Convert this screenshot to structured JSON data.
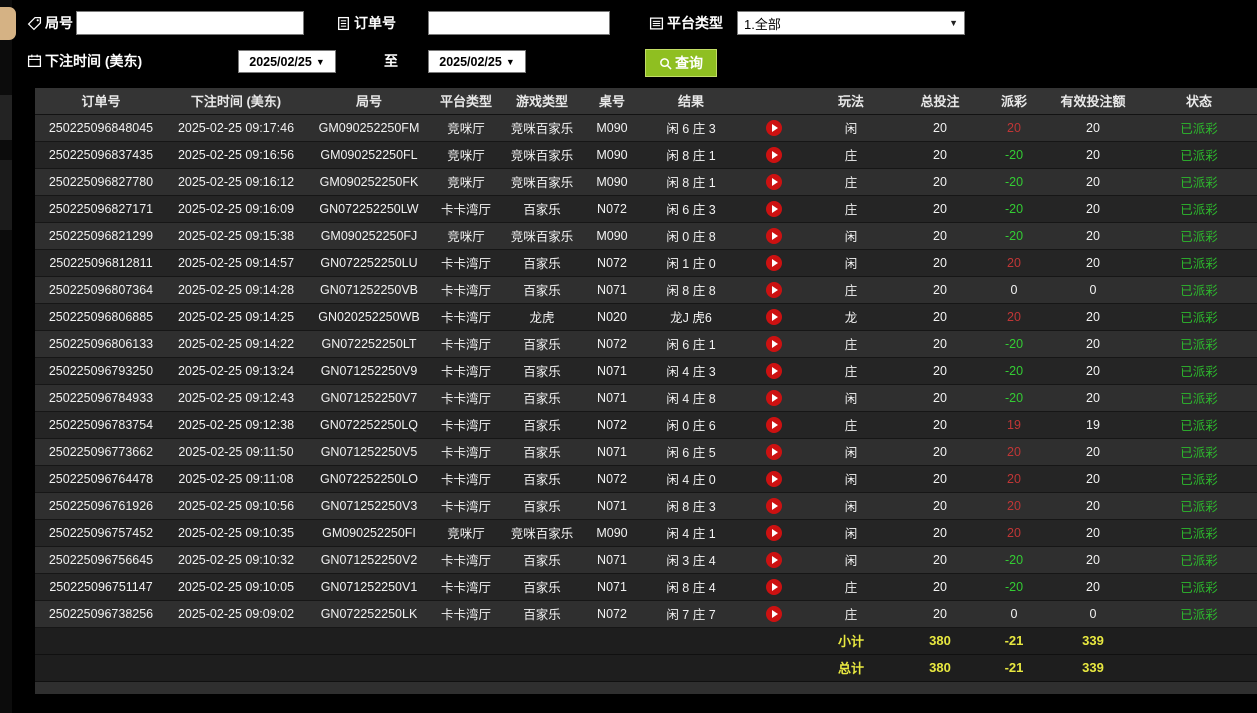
{
  "colors": {
    "query_button_green": "#8fbf21",
    "payout_positive_red": "#c03636",
    "payout_negative_green": "#33cc33",
    "status_green": "#2db82d",
    "summary_yellow": "#e8e840",
    "drawer_handle_tan": "#d5b284"
  },
  "icons": {
    "round": "tag-icon",
    "order": "document-icon",
    "platform": "list-icon",
    "bet_time": "calendar-icon",
    "query": "search-icon",
    "dropdown": "caret-down-icon",
    "replay": "play-icon"
  },
  "filters": {
    "round": {
      "label": "局号",
      "value": ""
    },
    "order": {
      "label": "订单号",
      "value": ""
    },
    "platform": {
      "label": "平台类型",
      "value": "1.全部",
      "arrow": "▼"
    },
    "bet_time": {
      "label": "下注时间 (美东)"
    },
    "date_from": "2025/02/25",
    "to_label": "至",
    "date_to": "2025/02/25",
    "date_arrow": "▼",
    "query_label": "查询"
  },
  "table": {
    "headers": [
      "订单号",
      "下注时间 (美东)",
      "局号",
      "平台类型",
      "游戏类型",
      "桌号",
      "结果",
      "",
      "玩法",
      "总投注",
      "派彩",
      "有效投注额",
      "状态"
    ],
    "rows": [
      {
        "order": "250225096848045",
        "time": "2025-02-25 09:17:46",
        "round": "GM090252250FM",
        "platform": "竞咪厅",
        "game": "竞咪百家乐",
        "table": "M090",
        "result": "闲 6 庄 3",
        "play": "闲",
        "bet": "20",
        "payout": "20",
        "payout_color": "red",
        "valid": "20",
        "status": "已派彩"
      },
      {
        "order": "250225096837435",
        "time": "2025-02-25 09:16:56",
        "round": "GM090252250FL",
        "platform": "竞咪厅",
        "game": "竞咪百家乐",
        "table": "M090",
        "result": "闲 8 庄 1",
        "play": "庄",
        "bet": "20",
        "payout": "-20",
        "payout_color": "green",
        "valid": "20",
        "status": "已派彩"
      },
      {
        "order": "250225096827780",
        "time": "2025-02-25 09:16:12",
        "round": "GM090252250FK",
        "platform": "竞咪厅",
        "game": "竞咪百家乐",
        "table": "M090",
        "result": "闲 8 庄 1",
        "play": "庄",
        "bet": "20",
        "payout": "-20",
        "payout_color": "green",
        "valid": "20",
        "status": "已派彩"
      },
      {
        "order": "250225096827171",
        "time": "2025-02-25 09:16:09",
        "round": "GN072252250LW",
        "platform": "卡卡湾厅",
        "game": "百家乐",
        "table": "N072",
        "result": "闲 6 庄 3",
        "play": "庄",
        "bet": "20",
        "payout": "-20",
        "payout_color": "green",
        "valid": "20",
        "status": "已派彩"
      },
      {
        "order": "250225096821299",
        "time": "2025-02-25 09:15:38",
        "round": "GM090252250FJ",
        "platform": "竞咪厅",
        "game": "竞咪百家乐",
        "table": "M090",
        "result": "闲 0 庄 8",
        "play": "闲",
        "bet": "20",
        "payout": "-20",
        "payout_color": "green",
        "valid": "20",
        "status": "已派彩"
      },
      {
        "order": "250225096812811",
        "time": "2025-02-25 09:14:57",
        "round": "GN072252250LU",
        "platform": "卡卡湾厅",
        "game": "百家乐",
        "table": "N072",
        "result": "闲 1 庄 0",
        "play": "闲",
        "bet": "20",
        "payout": "20",
        "payout_color": "red",
        "valid": "20",
        "status": "已派彩"
      },
      {
        "order": "250225096807364",
        "time": "2025-02-25 09:14:28",
        "round": "GN071252250VB",
        "platform": "卡卡湾厅",
        "game": "百家乐",
        "table": "N071",
        "result": "闲 8 庄 8",
        "play": "庄",
        "bet": "20",
        "payout": "0",
        "payout_color": "white",
        "valid": "0",
        "status": "已派彩"
      },
      {
        "order": "250225096806885",
        "time": "2025-02-25 09:14:25",
        "round": "GN020252250WB",
        "platform": "卡卡湾厅",
        "game": "龙虎",
        "table": "N020",
        "result": "龙J 虎6",
        "play": "龙",
        "bet": "20",
        "payout": "20",
        "payout_color": "red",
        "valid": "20",
        "status": "已派彩"
      },
      {
        "order": "250225096806133",
        "time": "2025-02-25 09:14:22",
        "round": "GN072252250LT",
        "platform": "卡卡湾厅",
        "game": "百家乐",
        "table": "N072",
        "result": "闲 6 庄 1",
        "play": "庄",
        "bet": "20",
        "payout": "-20",
        "payout_color": "green",
        "valid": "20",
        "status": "已派彩"
      },
      {
        "order": "250225096793250",
        "time": "2025-02-25 09:13:24",
        "round": "GN071252250V9",
        "platform": "卡卡湾厅",
        "game": "百家乐",
        "table": "N071",
        "result": "闲 4 庄 3",
        "play": "庄",
        "bet": "20",
        "payout": "-20",
        "payout_color": "green",
        "valid": "20",
        "status": "已派彩"
      },
      {
        "order": "250225096784933",
        "time": "2025-02-25 09:12:43",
        "round": "GN071252250V7",
        "platform": "卡卡湾厅",
        "game": "百家乐",
        "table": "N071",
        "result": "闲 4 庄 8",
        "play": "闲",
        "bet": "20",
        "payout": "-20",
        "payout_color": "green",
        "valid": "20",
        "status": "已派彩"
      },
      {
        "order": "250225096783754",
        "time": "2025-02-25 09:12:38",
        "round": "GN072252250LQ",
        "platform": "卡卡湾厅",
        "game": "百家乐",
        "table": "N072",
        "result": "闲 0 庄 6",
        "play": "庄",
        "bet": "20",
        "payout": "19",
        "payout_color": "red",
        "valid": "19",
        "status": "已派彩"
      },
      {
        "order": "250225096773662",
        "time": "2025-02-25 09:11:50",
        "round": "GN071252250V5",
        "platform": "卡卡湾厅",
        "game": "百家乐",
        "table": "N071",
        "result": "闲 6 庄 5",
        "play": "闲",
        "bet": "20",
        "payout": "20",
        "payout_color": "red",
        "valid": "20",
        "status": "已派彩"
      },
      {
        "order": "250225096764478",
        "time": "2025-02-25 09:11:08",
        "round": "GN072252250LO",
        "platform": "卡卡湾厅",
        "game": "百家乐",
        "table": "N072",
        "result": "闲 4 庄 0",
        "play": "闲",
        "bet": "20",
        "payout": "20",
        "payout_color": "red",
        "valid": "20",
        "status": "已派彩"
      },
      {
        "order": "250225096761926",
        "time": "2025-02-25 09:10:56",
        "round": "GN071252250V3",
        "platform": "卡卡湾厅",
        "game": "百家乐",
        "table": "N071",
        "result": "闲 8 庄 3",
        "play": "闲",
        "bet": "20",
        "payout": "20",
        "payout_color": "red",
        "valid": "20",
        "status": "已派彩"
      },
      {
        "order": "250225096757452",
        "time": "2025-02-25 09:10:35",
        "round": "GM090252250FI",
        "platform": "竞咪厅",
        "game": "竞咪百家乐",
        "table": "M090",
        "result": "闲 4 庄 1",
        "play": "闲",
        "bet": "20",
        "payout": "20",
        "payout_color": "red",
        "valid": "20",
        "status": "已派彩"
      },
      {
        "order": "250225096756645",
        "time": "2025-02-25 09:10:32",
        "round": "GN071252250V2",
        "platform": "卡卡湾厅",
        "game": "百家乐",
        "table": "N071",
        "result": "闲 3 庄 4",
        "play": "闲",
        "bet": "20",
        "payout": "-20",
        "payout_color": "green",
        "valid": "20",
        "status": "已派彩"
      },
      {
        "order": "250225096751147",
        "time": "2025-02-25 09:10:05",
        "round": "GN071252250V1",
        "platform": "卡卡湾厅",
        "game": "百家乐",
        "table": "N071",
        "result": "闲 8 庄 4",
        "play": "庄",
        "bet": "20",
        "payout": "-20",
        "payout_color": "green",
        "valid": "20",
        "status": "已派彩"
      },
      {
        "order": "250225096738256",
        "time": "2025-02-25 09:09:02",
        "round": "GN072252250LK",
        "platform": "卡卡湾厅",
        "game": "百家乐",
        "table": "N072",
        "result": "闲 7 庄 7",
        "play": "庄",
        "bet": "20",
        "payout": "0",
        "payout_color": "white",
        "valid": "0",
        "status": "已派彩"
      }
    ],
    "subtotal": {
      "label": "小计",
      "total_bet": "380",
      "payout": "-21",
      "valid_bet": "339"
    },
    "total": {
      "label": "总计",
      "total_bet": "380",
      "payout": "-21",
      "valid_bet": "339"
    }
  }
}
